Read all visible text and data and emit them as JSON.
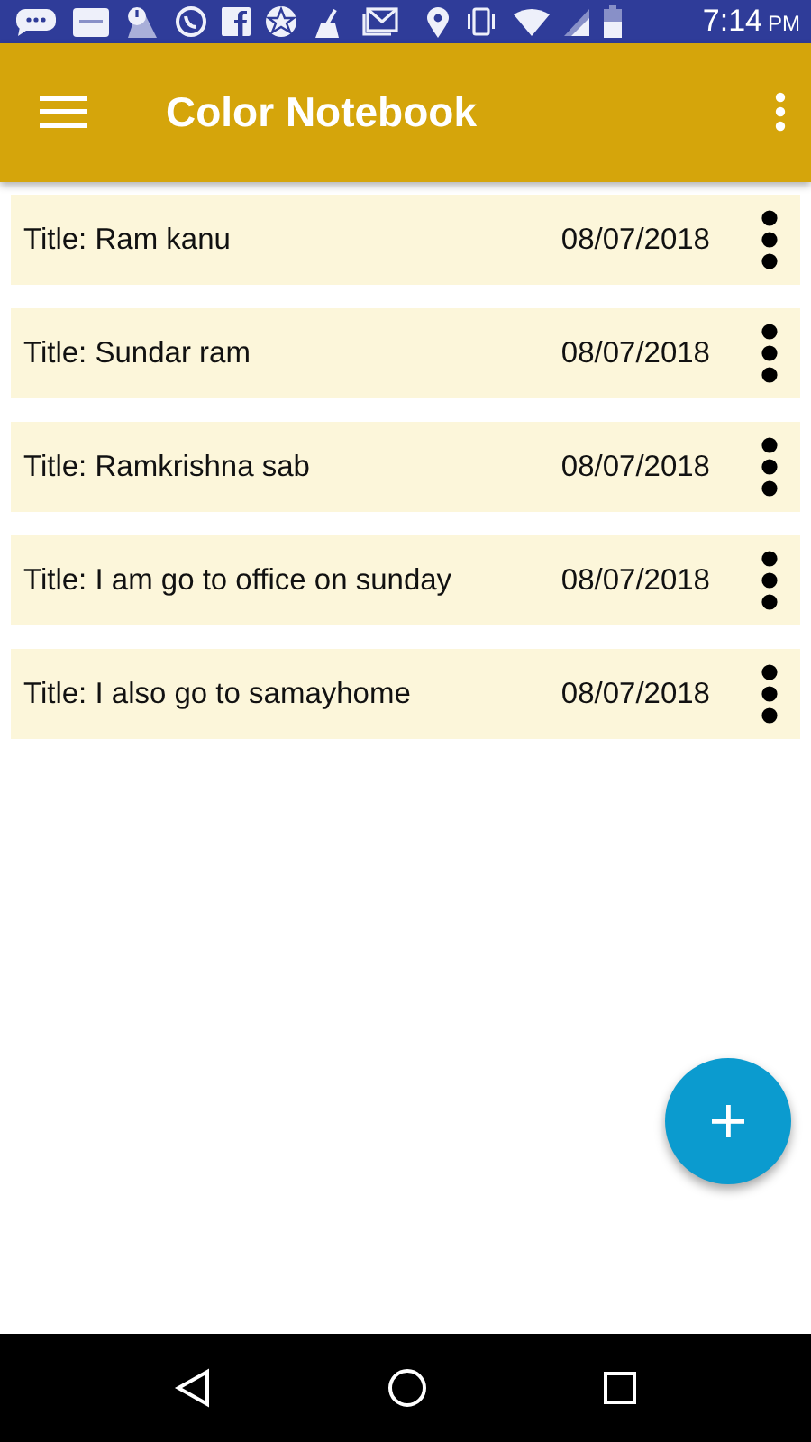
{
  "status_bar": {
    "time": "7:14",
    "period": "PM"
  },
  "app_bar": {
    "title": "Color Notebook"
  },
  "notes": [
    {
      "title": "Title: Ram kanu",
      "date": "08/07/2018"
    },
    {
      "title": "Title: Sundar ram",
      "date": "08/07/2018"
    },
    {
      "title": "Title: Ramkrishna sab",
      "date": "08/07/2018"
    },
    {
      "title": "Title: I am go to office on sunday",
      "date": "08/07/2018"
    },
    {
      "title": "Title: I also go to samayhome",
      "date": "08/07/2018"
    }
  ]
}
